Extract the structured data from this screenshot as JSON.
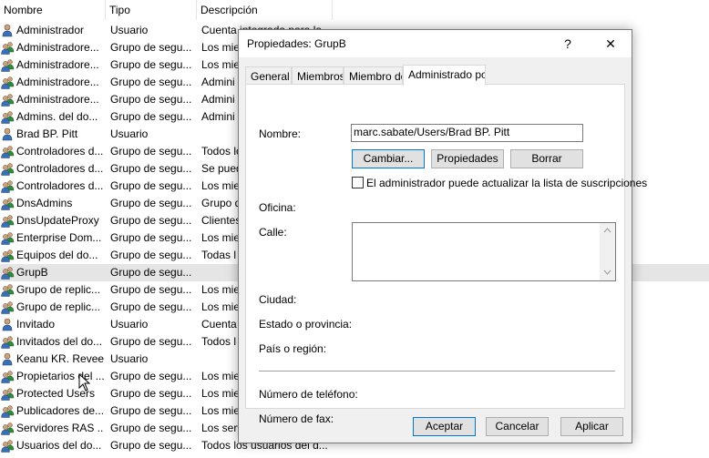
{
  "list": {
    "headers": [
      "Nombre",
      "Tipo",
      "Descripción"
    ],
    "rows": [
      {
        "name": "Administrador",
        "type": "Usuario",
        "desc": "Cuenta integrada para la",
        "icon": "user-icon"
      },
      {
        "name": "Administradore...",
        "type": "Grupo de segu...",
        "desc": "Los mie",
        "icon": "group-icon"
      },
      {
        "name": "Administradore...",
        "type": "Grupo de segu...",
        "desc": "Los mie",
        "icon": "group-icon"
      },
      {
        "name": "Administradore...",
        "type": "Grupo de segu...",
        "desc": "Admini",
        "icon": "group-icon"
      },
      {
        "name": "Administradore...",
        "type": "Grupo de segu...",
        "desc": "Admini",
        "icon": "group-icon"
      },
      {
        "name": "Admins. del do...",
        "type": "Grupo de segu...",
        "desc": "Admini",
        "icon": "group-icon"
      },
      {
        "name": "Brad BP. Pitt",
        "type": "Usuario",
        "desc": "",
        "icon": "user-icon"
      },
      {
        "name": "Controladores d...",
        "type": "Grupo de segu...",
        "desc": "Todos lo",
        "icon": "group-icon"
      },
      {
        "name": "Controladores d...",
        "type": "Grupo de segu...",
        "desc": "Se pued",
        "icon": "group-icon"
      },
      {
        "name": "Controladores d...",
        "type": "Grupo de segu...",
        "desc": "Los mie",
        "icon": "group-icon"
      },
      {
        "name": "DnsAdmins",
        "type": "Grupo de segu...",
        "desc": "Grupo d",
        "icon": "group-icon"
      },
      {
        "name": "DnsUpdateProxy",
        "type": "Grupo de segu...",
        "desc": "Clientes",
        "icon": "group-icon"
      },
      {
        "name": "Enterprise Dom...",
        "type": "Grupo de segu...",
        "desc": "Los mie",
        "icon": "group-icon"
      },
      {
        "name": "Equipos del do...",
        "type": "Grupo de segu...",
        "desc": "Todas l",
        "icon": "group-icon"
      },
      {
        "name": "GrupB",
        "type": "Grupo de segu...",
        "desc": "",
        "icon": "group-icon",
        "selected": true
      },
      {
        "name": "Grupo de replic...",
        "type": "Grupo de segu...",
        "desc": "Los mie",
        "icon": "group-icon"
      },
      {
        "name": "Grupo de replic...",
        "type": "Grupo de segu...",
        "desc": "Los mie",
        "icon": "group-icon"
      },
      {
        "name": "Invitado",
        "type": "Usuario",
        "desc": "Cuenta",
        "icon": "user-icon"
      },
      {
        "name": "Invitados del do...",
        "type": "Grupo de segu...",
        "desc": "Todos l",
        "icon": "group-icon"
      },
      {
        "name": "Keanu KR. Revees",
        "type": "Usuario",
        "desc": "",
        "icon": "user-icon"
      },
      {
        "name": "Propietarios del ...",
        "type": "Grupo de segu...",
        "desc": "Los mie",
        "icon": "group-icon"
      },
      {
        "name": "Protected Users",
        "type": "Grupo de segu...",
        "desc": "Los mie",
        "icon": "group-icon"
      },
      {
        "name": "Publicadores de...",
        "type": "Grupo de segu...",
        "desc": "Los mie",
        "icon": "group-icon"
      },
      {
        "name": "Servidores RAS ...",
        "type": "Grupo de segu...",
        "desc": "Los serv",
        "icon": "group-icon"
      },
      {
        "name": "Usuarios del do...",
        "type": "Grupo de segu...",
        "desc": "Todos los usuarios del d...",
        "icon": "group-icon"
      }
    ]
  },
  "dialog": {
    "title": "Propiedades: GrupB",
    "help_label": "?",
    "close_label": "✕",
    "tabs": [
      "General",
      "Miembros",
      "Miembro de",
      "Administrado por"
    ],
    "fields": {
      "nombre_label": "Nombre:",
      "nombre_value": "marc.sabate/Users/Brad BP. Pitt",
      "cambiar_label": "Cambiar...",
      "propiedades_label": "Propiedades",
      "borrar_label": "Borrar",
      "checkbox_label": "El administrador puede actualizar la lista de suscripciones",
      "oficina_label": "Oficina:",
      "calle_label": "Calle:",
      "ciudad_label": "Ciudad:",
      "estado_label": "Estado o provincia:",
      "pais_label": "País o región:",
      "telefono_label": "Número de teléfono:",
      "fax_label": "Número de fax:"
    },
    "buttons": {
      "aceptar": "Aceptar",
      "cancelar": "Cancelar",
      "aplicar": "Aplicar"
    }
  },
  "colors": {
    "selection": "#e5e5e5",
    "accent": "#0078d7",
    "dialog_bg": "#f0f0f0"
  }
}
